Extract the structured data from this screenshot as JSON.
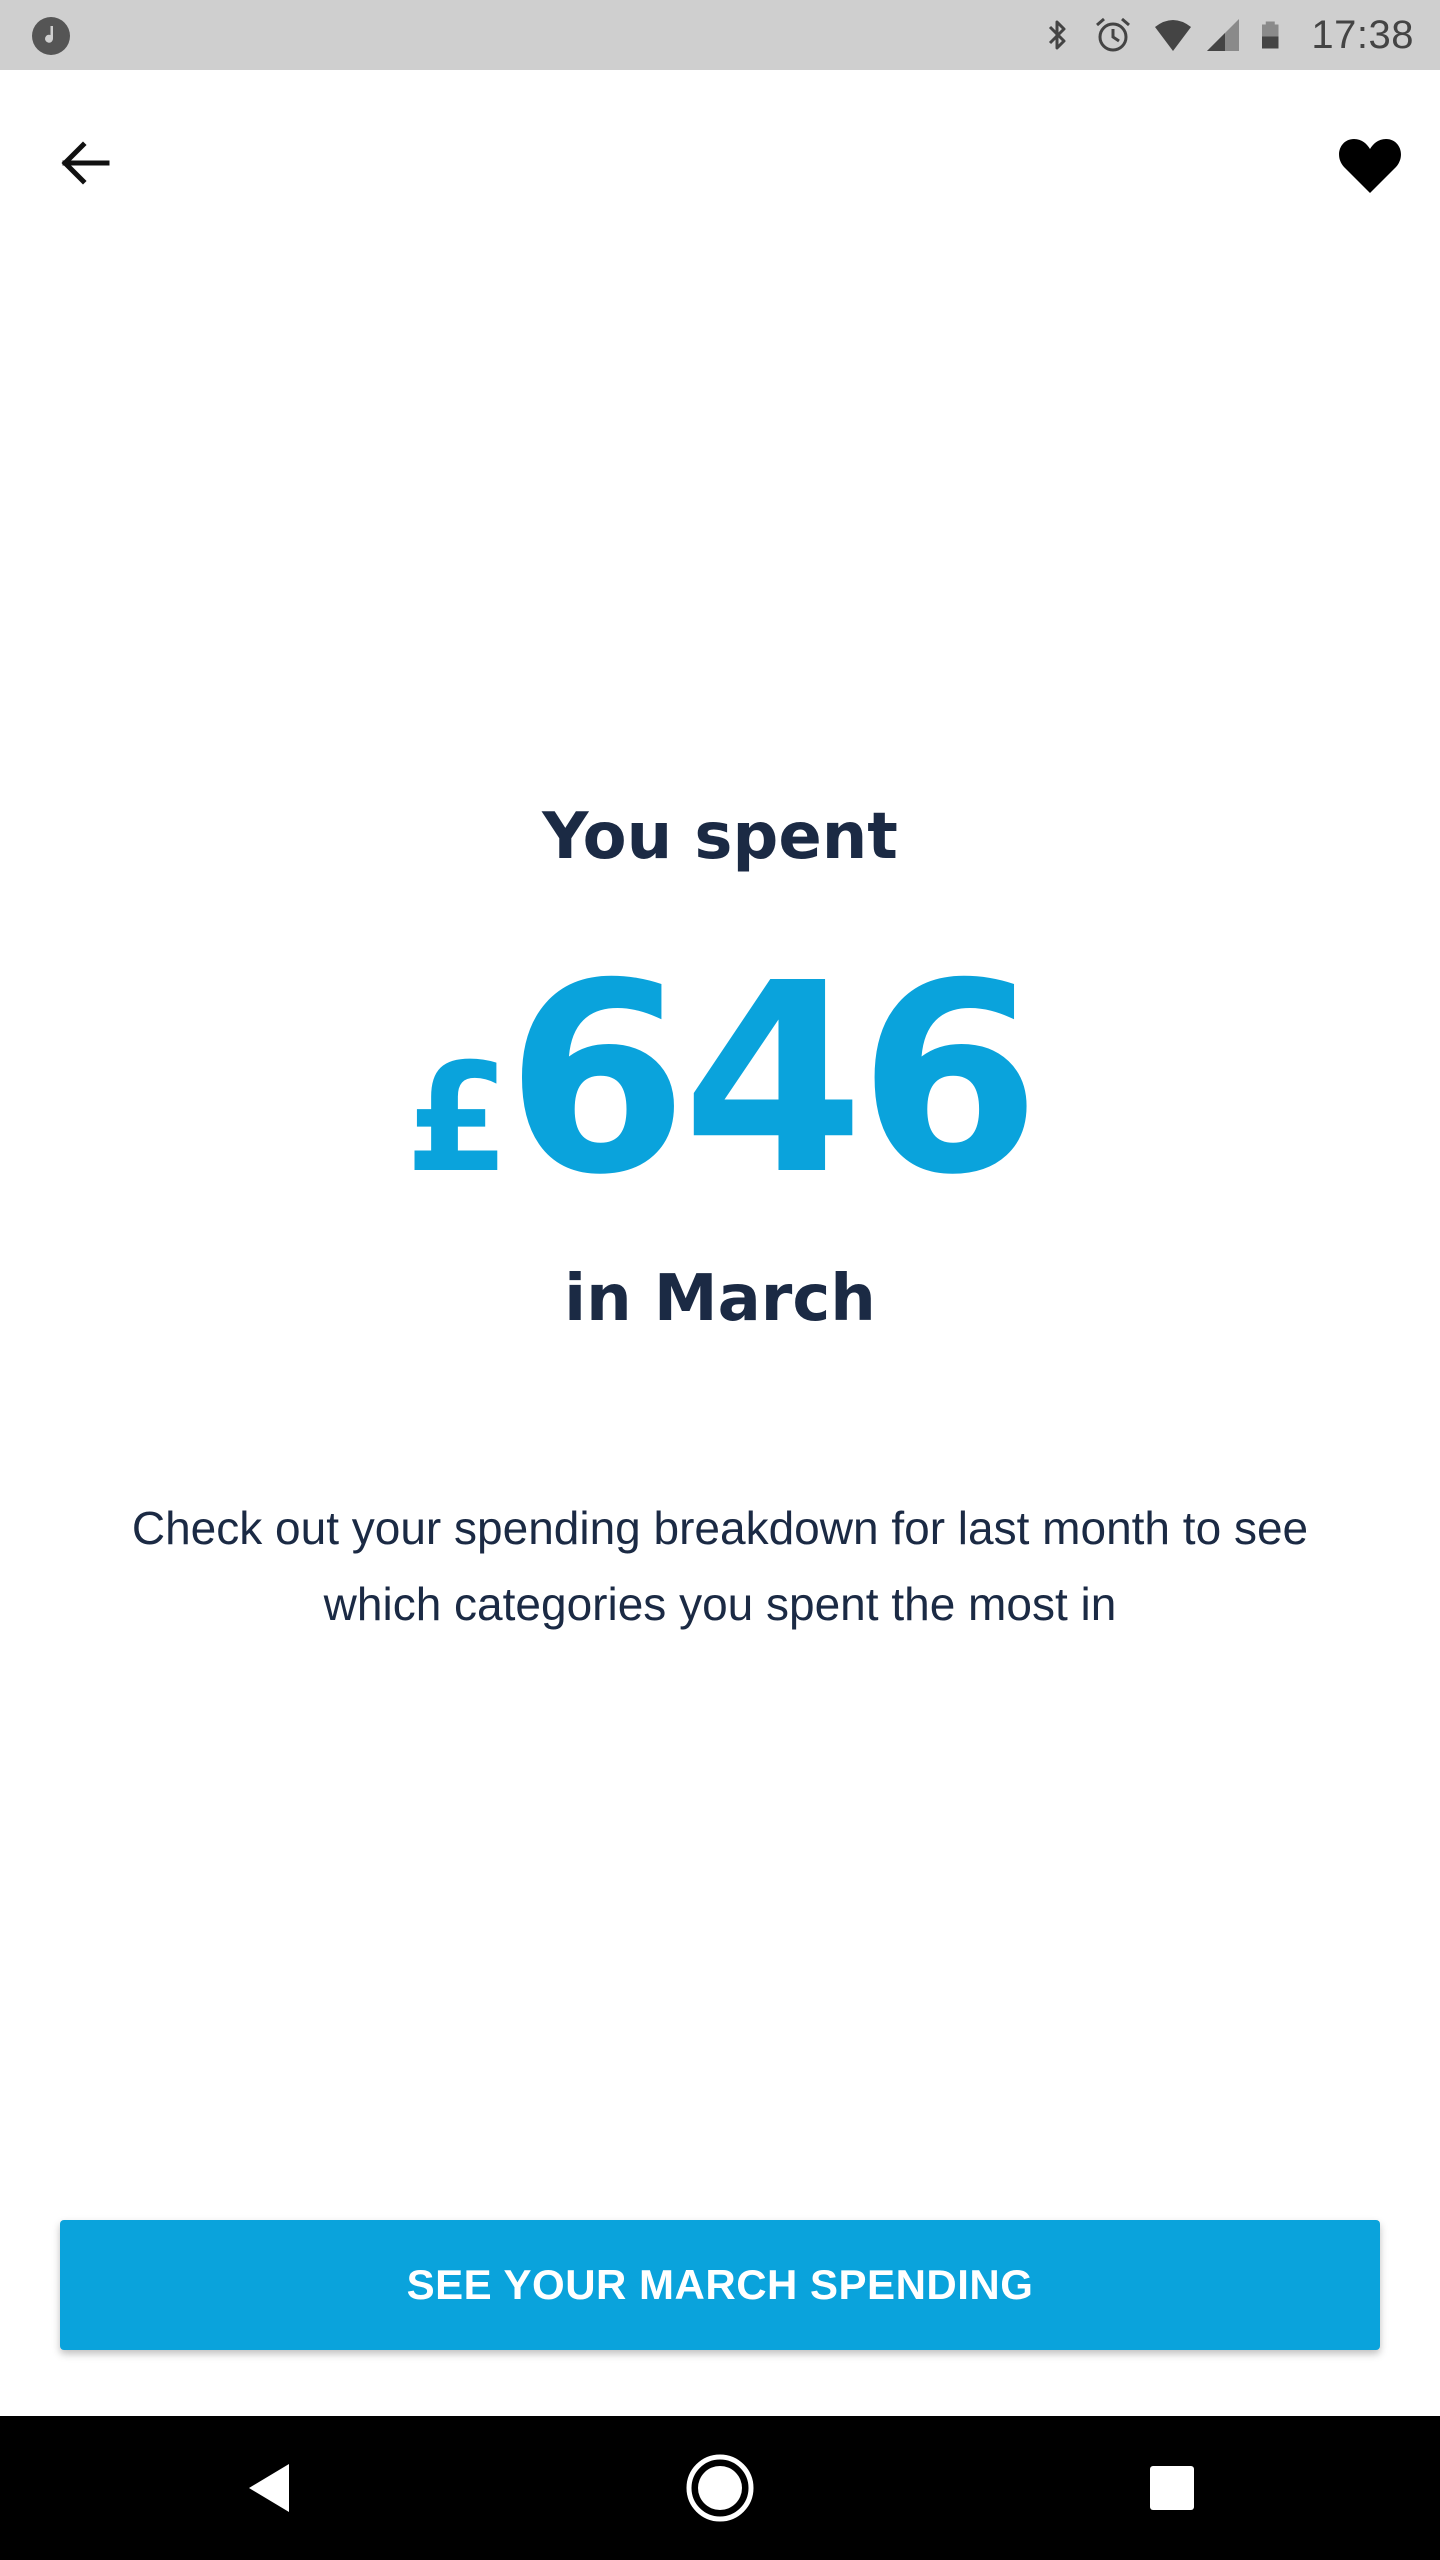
{
  "status_bar": {
    "time": "17:38",
    "icons": [
      "music-notification-icon",
      "bluetooth-icon",
      "alarm-icon",
      "wifi-icon",
      "cell-signal-icon",
      "battery-icon"
    ]
  },
  "app_bar": {
    "back_icon": "arrow-back-icon",
    "favorite_icon": "heart-icon"
  },
  "main": {
    "heading": "You spent",
    "currency_symbol": "£",
    "amount": "646",
    "month_line": "in March",
    "description": "Check out your spending breakdown for last month to see which categories you spent the most in"
  },
  "cta": {
    "label": "SEE YOUR MARCH SPENDING"
  },
  "nav_bar": {
    "buttons": [
      "nav-back-icon",
      "nav-home-icon",
      "nav-recents-icon"
    ]
  },
  "colors": {
    "accent": "#0aa3dc",
    "text_dark": "#1b2a44",
    "status_bar": "#cfcfcf",
    "nav_bar": "#000000"
  }
}
